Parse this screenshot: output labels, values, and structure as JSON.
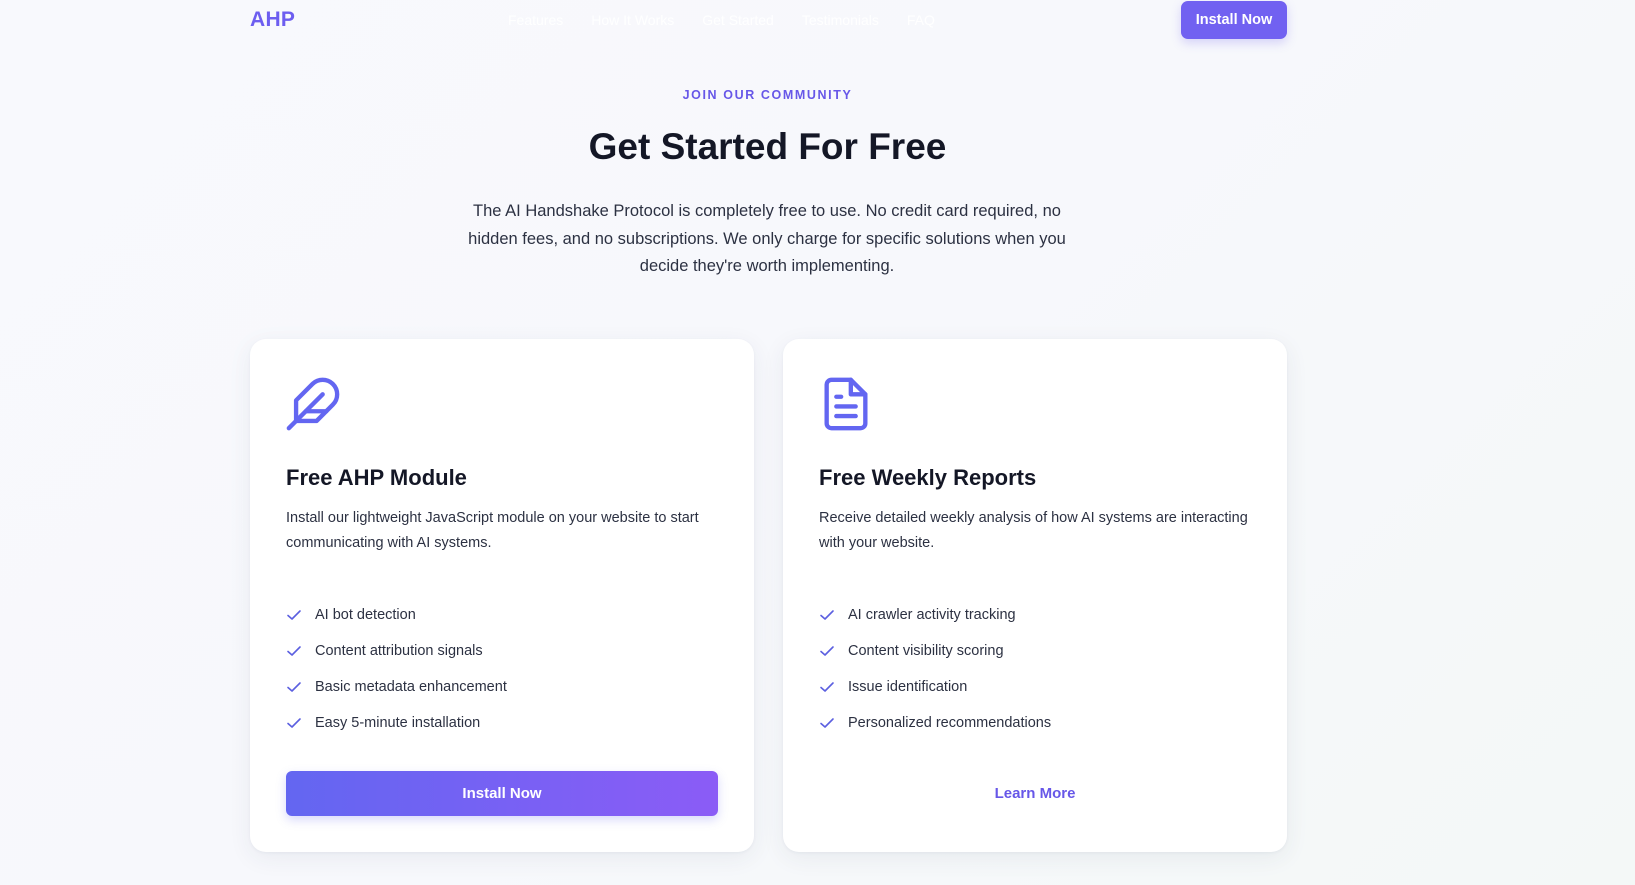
{
  "nav": {
    "logo": "AHP",
    "links": [
      "Features",
      "How It Works",
      "Get Started",
      "Testimonials",
      "FAQ"
    ],
    "cta_label": "Install Now"
  },
  "hero": {
    "eyebrow": "JOIN OUR COMMUNITY",
    "title": "Get Started For Free",
    "lead": "The AI Handshake Protocol is completely free to use. No credit card required, no hidden fees, and no subscriptions. We only charge for specific solutions when you decide they're worth implementing."
  },
  "cards": [
    {
      "icon": "feather-icon",
      "title": "Free AHP Module",
      "description": "Install our lightweight JavaScript module on your website to start communicating with AI systems.",
      "features": [
        "AI bot detection",
        "Content attribution signals",
        "Basic metadata enhancement",
        "Easy 5-minute installation"
      ],
      "button_label": "Install Now"
    },
    {
      "icon": "document-icon",
      "title": "Free Weekly Reports",
      "description": "Receive detailed weekly analysis of how AI systems are interacting with your website.",
      "features": [
        "AI crawler activity tracking",
        "Content visibility scoring",
        "Issue identification",
        "Personalized recommendations"
      ],
      "button_label": "Learn More"
    }
  ],
  "colors": {
    "accent": "#6757e8",
    "button_gradient_start": "#6366f1",
    "button_gradient_end": "#8b5cf6",
    "heading": "#141726"
  }
}
